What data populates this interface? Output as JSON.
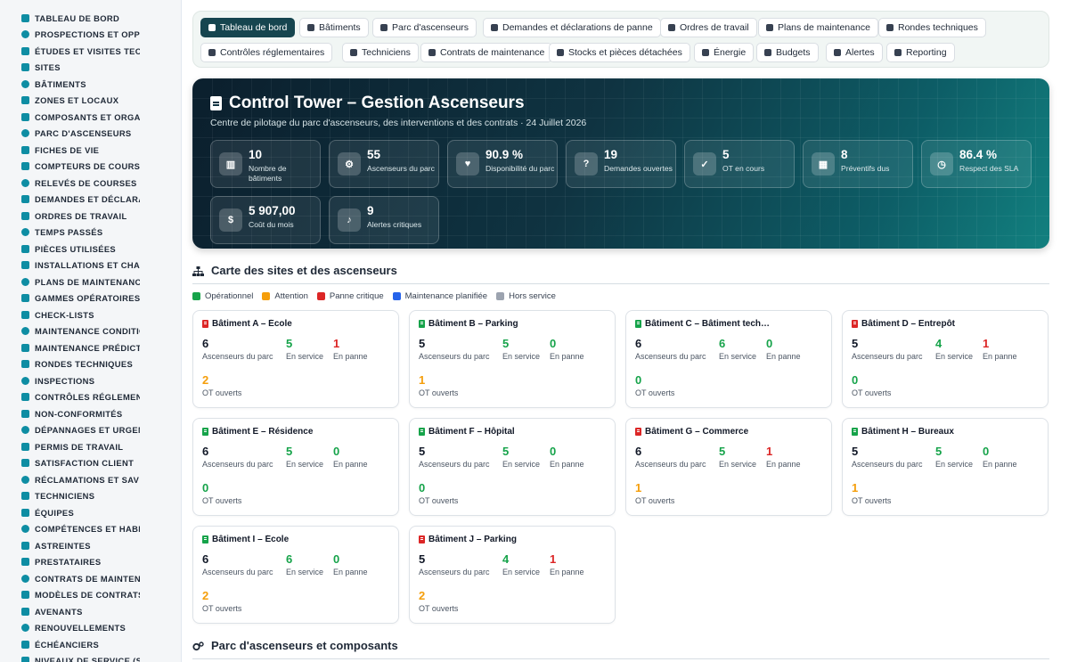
{
  "colors": {
    "accent": "#16454f",
    "teal_icon": "#0e8da3",
    "ok": "#16a34a",
    "warn": "#f59e0b",
    "critical": "#dc2626",
    "planned": "#2563eb",
    "off": "#9ca3af",
    "neutral": "#111827"
  },
  "sidebar": {
    "items": [
      {
        "label": "Tableau de bord",
        "icon": "gauge-icon"
      },
      {
        "label": "Prospections et opportunités",
        "icon": "target-icon"
      },
      {
        "label": "Études et visites techniques",
        "icon": "clipboard-icon"
      },
      {
        "label": "Sites",
        "icon": "map-pin-icon"
      },
      {
        "label": "Bâtiments",
        "icon": "building-icon"
      },
      {
        "label": "Zones et locaux",
        "icon": "sitemap-icon"
      },
      {
        "label": "Composants et organes",
        "icon": "cubes-icon"
      },
      {
        "label": "Parc d'ascenseurs",
        "icon": "cogs-icon"
      },
      {
        "label": "Fiches de vie",
        "icon": "history-icon"
      },
      {
        "label": "Compteurs de courses",
        "icon": "counter-icon"
      },
      {
        "label": "Relevés de courses",
        "icon": "readings-icon"
      },
      {
        "label": "Demandes et déclarations de panne",
        "icon": "question-icon"
      },
      {
        "label": "Ordres de travail",
        "icon": "clipboard-check-icon"
      },
      {
        "label": "Temps passés",
        "icon": "clock-icon"
      },
      {
        "label": "Pièces utilisées",
        "icon": "parts-icon"
      },
      {
        "label": "Installations et chantiers",
        "icon": "wrench-icon"
      },
      {
        "label": "Plans de maintenance",
        "icon": "calendar-icon"
      },
      {
        "label": "Gammes opératoires",
        "icon": "list-icon"
      },
      {
        "label": "Check-lists",
        "icon": "checklist-icon"
      },
      {
        "label": "Maintenance conditionnelle",
        "icon": "thermometer-icon"
      },
      {
        "label": "Maintenance prédictive",
        "icon": "chart-icon"
      },
      {
        "label": "Rondes techniques",
        "icon": "route-icon"
      },
      {
        "label": "Inspections",
        "icon": "search-icon"
      },
      {
        "label": "Contrôles réglementaires",
        "icon": "shield-icon"
      },
      {
        "label": "Non-conformités",
        "icon": "warning-icon"
      },
      {
        "label": "Dépannages et urgences",
        "icon": "truck-icon"
      },
      {
        "label": "Permis de travail",
        "icon": "file-icon"
      },
      {
        "label": "Satisfaction client",
        "icon": "smile-icon"
      },
      {
        "label": "Réclamations et SAV",
        "icon": "comment-icon"
      },
      {
        "label": "Techniciens",
        "icon": "user-icon"
      },
      {
        "label": "Équipes",
        "icon": "users-icon"
      },
      {
        "label": "Compétences et habilitations",
        "icon": "certificate-icon"
      },
      {
        "label": "Astreintes",
        "icon": "phone-icon"
      },
      {
        "label": "Prestataires",
        "icon": "handshake-icon"
      },
      {
        "label": "Contrats de maintenance",
        "icon": "contract-icon"
      },
      {
        "label": "Modèles de contrats",
        "icon": "template-icon"
      },
      {
        "label": "Avenants",
        "icon": "edit-icon"
      },
      {
        "label": "Renouvellements",
        "icon": "refresh-icon"
      },
      {
        "label": "Échéanciers",
        "icon": "schedule-icon"
      },
      {
        "label": "Niveaux de service (SLA)",
        "icon": "sla-icon"
      }
    ]
  },
  "tabs": [
    {
      "label": "Tableau de bord",
      "active": true
    },
    {
      "label": "Bâtiments"
    },
    {
      "label": "Parc d'ascenseurs"
    },
    {
      "label": "Demandes et déclarations de panne"
    },
    {
      "label": "Ordres de travail"
    },
    {
      "label": "Plans de maintenance"
    },
    {
      "label": "Rondes techniques"
    },
    {
      "label": "Contrôles réglementaires"
    },
    {
      "label": "Techniciens"
    },
    {
      "label": "Contrats de maintenance"
    },
    {
      "label": "Stocks et pièces détachées"
    },
    {
      "label": "Énergie"
    },
    {
      "label": "Budgets"
    },
    {
      "label": "Alertes"
    },
    {
      "label": "Reporting"
    }
  ],
  "hero": {
    "title": "Control Tower – Gestion Ascenseurs",
    "subtitle": "Centre de pilotage du parc d'ascenseurs, des interventions et des contrats · 24 Juillet 2026",
    "kpis": [
      {
        "value": "10",
        "label": "Nombre de bâtiments",
        "icon": "building-icon"
      },
      {
        "value": "55",
        "label": "Ascenseurs du parc",
        "icon": "cogs-icon"
      },
      {
        "value": "90.9 %",
        "label": "Disponibilité du parc",
        "icon": "heartbeat-icon"
      },
      {
        "value": "19",
        "label": "Demandes ouvertes",
        "icon": "question-icon"
      },
      {
        "value": "5",
        "label": "OT en cours",
        "icon": "clipboard-check-icon"
      },
      {
        "value": "8",
        "label": "Préventifs dus",
        "icon": "calendar-icon"
      },
      {
        "value": "86.4 %",
        "label": "Respect des SLA",
        "icon": "stopwatch-icon"
      },
      {
        "value": "5 907,00",
        "label": "Coût du mois",
        "icon": "money-icon"
      },
      {
        "value": "9",
        "label": "Alertes critiques",
        "icon": "bell-icon"
      }
    ]
  },
  "map": {
    "title": "Carte des sites et des ascenseurs",
    "legend": [
      {
        "label": "Opérationnel",
        "color": "#16a34a"
      },
      {
        "label": "Attention",
        "color": "#f59e0b"
      },
      {
        "label": "Panne critique",
        "color": "#dc2626"
      },
      {
        "label": "Maintenance planifiée",
        "color": "#2563eb"
      },
      {
        "label": "Hors service",
        "color": "#9ca3af"
      }
    ],
    "labels": {
      "parc": "Ascenseurs du parc",
      "service": "En service",
      "panne": "En panne",
      "ot": "OT ouverts"
    },
    "buildings": [
      {
        "name": "Bâtiment A – École",
        "status": "critical",
        "parc": 6,
        "service": 5,
        "panne": 1,
        "ot": 2
      },
      {
        "name": "Bâtiment B – Parking",
        "status": "ok",
        "parc": 5,
        "service": 5,
        "panne": 0,
        "ot": 1
      },
      {
        "name": "Bâtiment C – Bâtiment tech…",
        "status": "ok",
        "parc": 6,
        "service": 6,
        "panne": 0,
        "ot": 0
      },
      {
        "name": "Bâtiment D – Entrepôt",
        "status": "critical",
        "parc": 5,
        "service": 4,
        "panne": 1,
        "ot": 0
      },
      {
        "name": "Bâtiment E – Résidence",
        "status": "ok",
        "parc": 6,
        "service": 5,
        "panne": 0,
        "ot": 0
      },
      {
        "name": "Bâtiment F – Hôpital",
        "status": "ok",
        "parc": 5,
        "service": 5,
        "panne": 0,
        "ot": 0
      },
      {
        "name": "Bâtiment G – Commerce",
        "status": "critical",
        "parc": 6,
        "service": 5,
        "panne": 1,
        "ot": 1
      },
      {
        "name": "Bâtiment H – Bureaux",
        "status": "ok",
        "parc": 5,
        "service": 5,
        "panne": 0,
        "ot": 1
      },
      {
        "name": "Bâtiment I – École",
        "status": "ok",
        "parc": 6,
        "service": 6,
        "panne": 0,
        "ot": 2
      },
      {
        "name": "Bâtiment J – Parking",
        "status": "critical",
        "parc": 5,
        "service": 4,
        "panne": 1,
        "ot": 2
      }
    ]
  },
  "section2": {
    "title": "Parc d'ascenseurs et composants"
  }
}
